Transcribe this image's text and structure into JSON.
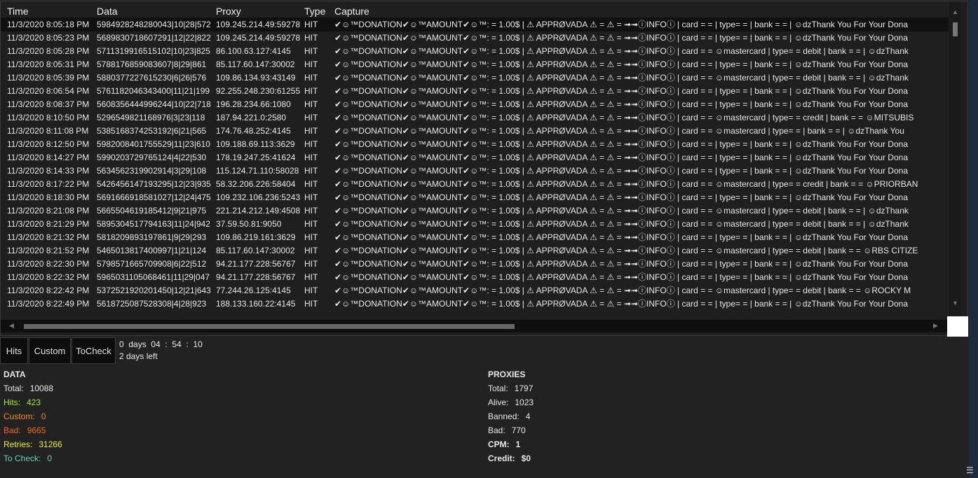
{
  "columns": [
    "Time",
    "Data",
    "Proxy",
    "Type",
    "Capture"
  ],
  "rows": [
    {
      "time": "11/3/2020 8:05:18 PM",
      "data": "5984928248280043|10|28|572",
      "proxy": "109.245.214.49:59278",
      "type": "HIT",
      "capture": "✔☺™DONATION✔☺™AMOUNT✔☺™: = 1.00$ |  ⚠ APPRØVADA ⚠ = ⚠ = ➟➟ⓘINFOⓘ | card = =  | type= =  | bank = =  |  ☺dzThank You For Your Dona"
    },
    {
      "time": "11/3/2020 8:05:23 PM",
      "data": "5689830718607291|12|22|822",
      "proxy": "109.245.214.49:59278",
      "type": "HIT",
      "capture": "✔☺™DONATION✔☺™AMOUNT✔☺™: = 1.00$ |  ⚠ APPRØVADA ⚠ = ⚠ = ➟➟ⓘINFOⓘ | card = =  | type= =  | bank = =  |  ☺dzThank You For Your Dona"
    },
    {
      "time": "11/3/2020 8:05:28 PM",
      "data": "5711319916515102|10|23|825",
      "proxy": "86.100.63.127:4145",
      "type": "HIT",
      "capture": "✔☺™DONATION✔☺™AMOUNT✔☺™: = 1.00$ |  ⚠ APPRØVADA ⚠ = ⚠ = ➟➟ⓘINFOⓘ | card = = ☺mastercard | type= = debit | bank = =  |  ☺dzThank"
    },
    {
      "time": "11/3/2020 8:05:31 PM",
      "data": "5788176859083607|8|29|861",
      "proxy": "85.117.60.147:30002",
      "type": "HIT",
      "capture": "✔☺™DONATION✔☺™AMOUNT✔☺™: = 1.00$ |  ⚠ APPRØVADA ⚠ = ⚠ = ➟➟ⓘINFOⓘ | card = =  | type= =  | bank = =  |  ☺dzThank You For Your Dona"
    },
    {
      "time": "11/3/2020 8:05:39 PM",
      "data": "5880377227615230|6|26|576",
      "proxy": "109.86.134.93:43149",
      "type": "HIT",
      "capture": "✔☺™DONATION✔☺™AMOUNT✔☺™: = 1.00$ |  ⚠ APPRØVADA ⚠ = ⚠ = ➟➟ⓘINFOⓘ | card = = ☺mastercard | type= = debit | bank = =  |  ☺dzThank"
    },
    {
      "time": "11/3/2020 8:06:54 PM",
      "data": "5761182046343400|11|21|199",
      "proxy": "92.255.248.230:61255",
      "type": "HIT",
      "capture": "✔☺™DONATION✔☺™AMOUNT✔☺™: = 1.00$ |  ⚠ APPRØVADA ⚠ = ⚠ = ➟➟ⓘINFOⓘ | card = =  | type= =  | bank = =  |  ☺dzThank You For Your Dona"
    },
    {
      "time": "11/3/2020 8:08:37 PM",
      "data": "5608356444996244|10|22|718",
      "proxy": "196.28.234.66:1080",
      "type": "HIT",
      "capture": "✔☺™DONATION✔☺™AMOUNT✔☺™: = 1.00$ |  ⚠ APPRØVADA ⚠ = ⚠ = ➟➟ⓘINFOⓘ | card = =  | type= =  | bank = =  |  ☺dzThank You For Your Dona"
    },
    {
      "time": "11/3/2020 8:10:50 PM",
      "data": "5296549821168976|3|23|118",
      "proxy": "187.94.221.0:2580",
      "type": "HIT",
      "capture": "✔☺™DONATION✔☺™AMOUNT✔☺™: = 1.00$ |  ⚠ APPRØVADA ⚠ = ⚠ = ➟➟ⓘINFOⓘ | card = = ☺mastercard | type= = credit | bank = = ☺MITSUBIS"
    },
    {
      "time": "11/3/2020 8:11:08 PM",
      "data": "5385168374253192|6|21|565",
      "proxy": "174.76.48.252:4145",
      "type": "HIT",
      "capture": "✔☺™DONATION✔☺™AMOUNT✔☺™: = 1.00$ |  ⚠ APPRØVADA ⚠ = ⚠ = ➟➟ⓘINFOⓘ | card = = ☺mastercard | type= =  | bank = =  |  ☺dzThank You"
    },
    {
      "time": "11/3/2020 8:12:50 PM",
      "data": "5982008401755529|11|23|610",
      "proxy": "109.188.69.113:3629",
      "type": "HIT",
      "capture": "✔☺™DONATION✔☺™AMOUNT✔☺™: = 1.00$ |  ⚠ APPRØVADA ⚠ = ⚠ = ➟➟ⓘINFOⓘ | card = =  | type= =  | bank = =  |  ☺dzThank You For Your Dona"
    },
    {
      "time": "11/3/2020 8:14:27 PM",
      "data": "5990203729765124|4|22|530",
      "proxy": "178.19.247.25:41624",
      "type": "HIT",
      "capture": "✔☺™DONATION✔☺™AMOUNT✔☺™: = 1.00$ |  ⚠ APPRØVADA ⚠ = ⚠ = ➟➟ⓘINFOⓘ | card = =  | type= =  | bank = =  |  ☺dzThank You For Your Dona"
    },
    {
      "time": "11/3/2020 8:14:33 PM",
      "data": "5634562319902914|3|29|108",
      "proxy": "115.124.71.110:58028",
      "type": "HIT",
      "capture": "✔☺™DONATION✔☺™AMOUNT✔☺™: = 1.00$ |  ⚠ APPRØVADA ⚠ = ⚠ = ➟➟ⓘINFOⓘ | card = =  | type= =  | bank = =  |  ☺dzThank You For Your Dona"
    },
    {
      "time": "11/3/2020 8:17:22 PM",
      "data": "5426456147193295|12|23|935",
      "proxy": "58.32.206.226:58404",
      "type": "HIT",
      "capture": "✔☺™DONATION✔☺™AMOUNT✔☺™: = 1.00$ |  ⚠ APPRØVADA ⚠ = ⚠ = ➟➟ⓘINFOⓘ | card = = ☺mastercard | type= = credit | bank = = ☺PRIORBAN"
    },
    {
      "time": "11/3/2020 8:18:30 PM",
      "data": "5691666918581027|12|24|475",
      "proxy": "109.232.106.236:5243",
      "type": "HIT",
      "capture": "✔☺™DONATION✔☺™AMOUNT✔☺™: = 1.00$ |  ⚠ APPRØVADA ⚠ = ⚠ = ➟➟ⓘINFOⓘ | card = =  | type= =  | bank = =  |  ☺dzThank You For Your Dona"
    },
    {
      "time": "11/3/2020 8:21:08 PM",
      "data": "5665504619185412|9|21|975",
      "proxy": "221.214.212.149:4508",
      "type": "HIT",
      "capture": "✔☺™DONATION✔☺™AMOUNT✔☺™: = 1.00$ |  ⚠ APPRØVADA ⚠ = ⚠ = ➟➟ⓘINFOⓘ | card = = ☺mastercard | type= = debit | bank = =  |  ☺dzThank"
    },
    {
      "time": "11/3/2020 8:21:29 PM",
      "data": "5895304517794163|11|24|942",
      "proxy": "37.59.50.81:9050",
      "type": "HIT",
      "capture": "✔☺™DONATION✔☺™AMOUNT✔☺™: = 1.00$ |  ⚠ APPRØVADA ⚠ = ⚠ = ➟➟ⓘINFOⓘ | card = = ☺mastercard | type= = debit | bank = =  |  ☺dzThank"
    },
    {
      "time": "11/3/2020 8:21:32 PM",
      "data": "5818209893197861|9|29|293",
      "proxy": "109.86.219.161:3629",
      "type": "HIT",
      "capture": "✔☺™DONATION✔☺™AMOUNT✔☺™: = 1.00$ |  ⚠ APPRØVADA ⚠ = ⚠ = ➟➟ⓘINFOⓘ | card = =  | type= =  | bank = =  |  ☺dzThank You For Your Dona"
    },
    {
      "time": "11/3/2020 8:21:52 PM",
      "data": "5465013817400997|1|21|124",
      "proxy": "85.117.60.147:30002",
      "type": "HIT",
      "capture": "✔☺™DONATION✔☺™AMOUNT✔☺™: = 1.00$ |  ⚠ APPRØVADA ⚠ = ⚠ = ➟➟ⓘINFOⓘ | card = = ☺mastercard | type= = debit | bank = = ☺RBS CITIZE"
    },
    {
      "time": "11/3/2020 8:22:30 PM",
      "data": "5798571665709908|6|22|512",
      "proxy": "94.21.177.228:56767",
      "type": "HIT",
      "capture": "✔☺™DONATION✔☺™AMOUNT✔☺™: = 1.00$ |  ⚠ APPRØVADA ⚠ = ⚠ = ➟➟ⓘINFOⓘ | card = =  | type= =  | bank = =  |  ☺dzThank You For Your Dona"
    },
    {
      "time": "11/3/2020 8:22:32 PM",
      "data": "5965031105068461|11|29|047",
      "proxy": "94.21.177.228:56767",
      "type": "HIT",
      "capture": "✔☺™DONATION✔☺™AMOUNT✔☺™: = 1.00$ |  ⚠ APPRØVADA ⚠ = ⚠ = ➟➟ⓘINFOⓘ | card = =  | type= =  | bank = =  |  ☺dzThank You For Your Dona"
    },
    {
      "time": "11/3/2020 8:22:42 PM",
      "data": "5372521920201450|12|21|643",
      "proxy": "77.244.26.125:4145",
      "type": "HIT",
      "capture": "✔☺™DONATION✔☺™AMOUNT✔☺™: = 1.00$ |  ⚠ APPRØVADA ⚠ = ⚠ = ➟➟ⓘINFOⓘ | card = = ☺mastercard | type= = debit | bank = = ☺ROCKY M"
    },
    {
      "time": "11/3/2020 8:22:49 PM",
      "data": "5618725087528308|4|28|923",
      "proxy": "188.133.160.22:4145",
      "type": "HIT",
      "capture": "✔☺™DONATION✔☺™AMOUNT✔☺™: = 1.00$ |  ⚠ APPRØVADA ⚠ = ⚠ = ➟➟ⓘINFOⓘ | card = =  | type= =  | bank = =  |  ☺dzThank You For Your Dona"
    }
  ],
  "tabs": [
    "Hits",
    "Custom",
    "ToCheck"
  ],
  "timer": {
    "elapsed": "0  days  04  :  54  :  10",
    "remaining": "2 days left"
  },
  "data_stats": {
    "title": "DATA",
    "items": [
      {
        "label": "Total:",
        "value": "10088",
        "color": "#e8e8e8"
      },
      {
        "label": "Hits:",
        "value": "423",
        "color": "#b5e61d"
      },
      {
        "label": "Custom:",
        "value": "0",
        "color": "#f28c28"
      },
      {
        "label": "Bad:",
        "value": "9665",
        "color": "#f26522"
      },
      {
        "label": "Retries:",
        "value": "31266",
        "color": "#e8f020"
      },
      {
        "label": "To Check:",
        "value": "0",
        "color": "#5fd3b3"
      }
    ]
  },
  "proxy_stats": {
    "title": "PROXIES",
    "items": [
      {
        "label": "Total:",
        "value": "1797",
        "bold": false
      },
      {
        "label": "Alive:",
        "value": "1023",
        "bold": false
      },
      {
        "label": "Banned:",
        "value": "4",
        "bold": false
      },
      {
        "label": "Bad:",
        "value": "770",
        "bold": false
      },
      {
        "label": "CPM:",
        "value": "1",
        "bold": true
      },
      {
        "label": "Credit:",
        "value": "$0",
        "bold": true
      }
    ]
  },
  "icons": {
    "menu": "hamburger-menu-icon"
  }
}
